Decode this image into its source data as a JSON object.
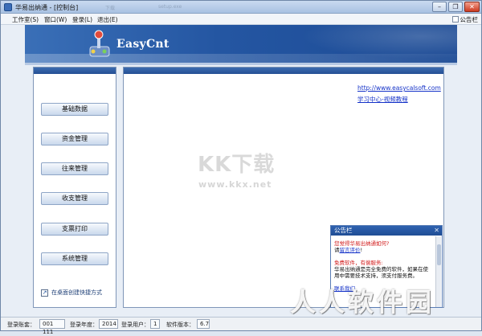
{
  "window": {
    "title": "华易出纳通 - [控制台]"
  },
  "titlebar_ghost": [
    "下载",
    "setup.exe"
  ],
  "menu": {
    "items": [
      "工作室(S)",
      "窗口(W)",
      "登录(L)",
      "退出(E)"
    ],
    "notice_toggle": "公告栏"
  },
  "banner": {
    "brand": "EasyCnt"
  },
  "nav": {
    "buttons": [
      "基础数据",
      "资金管理",
      "往来管理",
      "收支管理",
      "支票打印",
      "系统管理"
    ],
    "shortcut": "在桌面创建快捷方式"
  },
  "main": {
    "links": [
      "http://www.easycalsoft.com",
      "学习中心-视频教程"
    ]
  },
  "watermark": {
    "logo": "KK下载",
    "url": "www.kkx.net",
    "big": "人人软件园"
  },
  "notice": {
    "title": "公告栏",
    "line1": "您觉得华易出纳通如何?",
    "line2_prefix": "请",
    "line2_link": "留言评价",
    "line2_suffix": "!",
    "line3": "免费软件，有偿服务:",
    "line4": "华易出纳通是完全免费的软件，如果在使用中需要技术支持，须支付服务费。",
    "line5": "联系我们"
  },
  "status": {
    "fields": [
      {
        "label": "登录账套：",
        "value": "001 111"
      },
      {
        "label": "登录年度：",
        "value": "2014"
      },
      {
        "label": "登录用户：",
        "value": "1"
      },
      {
        "label": "软件版本：",
        "value": "6.7"
      }
    ]
  }
}
